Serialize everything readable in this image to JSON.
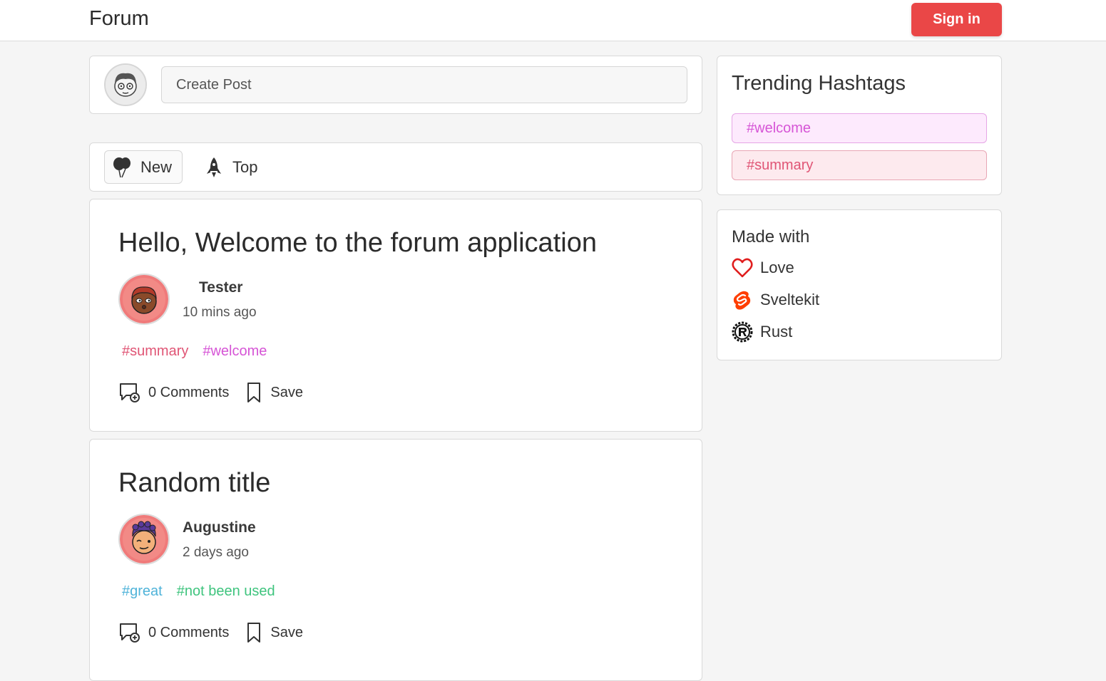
{
  "header": {
    "brand": "Forum",
    "signin_label": "Sign in"
  },
  "create_post": {
    "placeholder": "Create Post"
  },
  "sort": {
    "new_label": "New",
    "top_label": "Top"
  },
  "posts": [
    {
      "title": "Hello, Welcome to the forum application",
      "author": "Tester",
      "time": "10 mins ago",
      "tags": [
        "#summary",
        "#welcome"
      ],
      "tag_colors": [
        "#e05575",
        "#d655d6"
      ],
      "comments_label": "0 Comments",
      "save_label": "Save"
    },
    {
      "title": "Random title",
      "author": "Augustine",
      "time": "2 days ago",
      "tags": [
        "#great",
        "#not been used"
      ],
      "tag_colors": [
        "#4fb3d9",
        "#3fc47e"
      ],
      "comments_label": "0 Comments",
      "save_label": "Save"
    }
  ],
  "sidebar": {
    "trending": {
      "title": "Trending Hashtags",
      "chips": [
        {
          "label": "#welcome",
          "color": "#d655d6",
          "bg": "#fdeafd",
          "border": "#e6a6e6"
        },
        {
          "label": "#summary",
          "color": "#e05575",
          "bg": "#fdeaee",
          "border": "#e8a6b5"
        }
      ]
    },
    "made_with": {
      "title": "Made with",
      "items": [
        {
          "label": "Love",
          "icon": "heart-icon"
        },
        {
          "label": "Sveltekit",
          "icon": "svelte-icon"
        },
        {
          "label": "Rust",
          "icon": "rust-icon"
        }
      ]
    }
  },
  "colors": {
    "accent": "#ea4747"
  }
}
